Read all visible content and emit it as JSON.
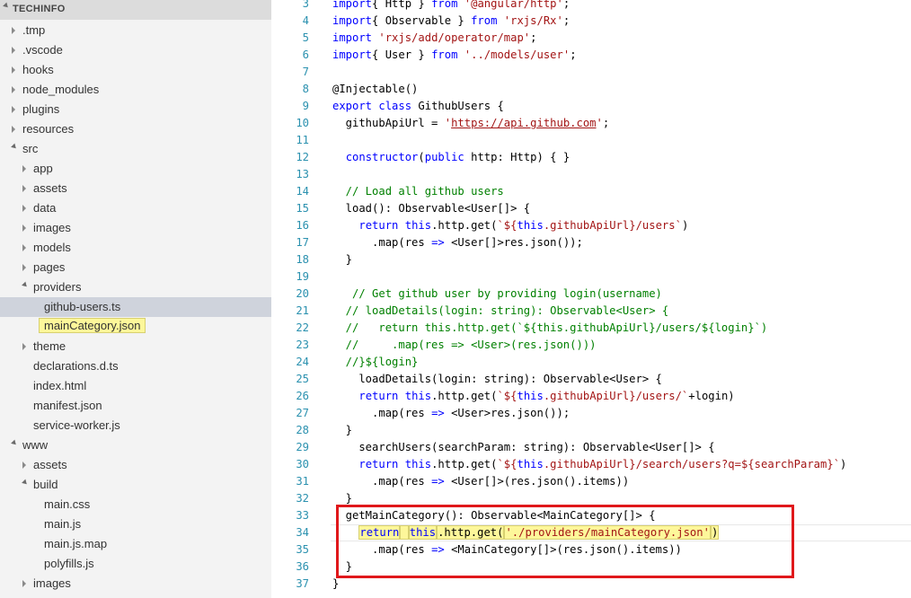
{
  "explorer": {
    "section_title": "TECHINFO",
    "items": [
      {
        "label": ".tmp",
        "depth": 1,
        "twisty": "closed"
      },
      {
        "label": ".vscode",
        "depth": 1,
        "twisty": "closed"
      },
      {
        "label": "hooks",
        "depth": 1,
        "twisty": "closed"
      },
      {
        "label": "node_modules",
        "depth": 1,
        "twisty": "closed"
      },
      {
        "label": "plugins",
        "depth": 1,
        "twisty": "closed"
      },
      {
        "label": "resources",
        "depth": 1,
        "twisty": "closed"
      },
      {
        "label": "src",
        "depth": 1,
        "twisty": "open"
      },
      {
        "label": "app",
        "depth": 2,
        "twisty": "closed"
      },
      {
        "label": "assets",
        "depth": 2,
        "twisty": "closed"
      },
      {
        "label": "data",
        "depth": 2,
        "twisty": "closed"
      },
      {
        "label": "images",
        "depth": 2,
        "twisty": "closed"
      },
      {
        "label": "models",
        "depth": 2,
        "twisty": "closed"
      },
      {
        "label": "pages",
        "depth": 2,
        "twisty": "closed"
      },
      {
        "label": "providers",
        "depth": 2,
        "twisty": "open"
      },
      {
        "label": "github-users.ts",
        "depth": 3,
        "twisty": "none",
        "selected": true
      },
      {
        "label": "mainCategory.json",
        "depth": 3,
        "twisty": "none",
        "highlighted": true
      },
      {
        "label": "theme",
        "depth": 2,
        "twisty": "closed"
      },
      {
        "label": "declarations.d.ts",
        "depth": 2,
        "twisty": "none"
      },
      {
        "label": "index.html",
        "depth": 2,
        "twisty": "none"
      },
      {
        "label": "manifest.json",
        "depth": 2,
        "twisty": "none"
      },
      {
        "label": "service-worker.js",
        "depth": 2,
        "twisty": "none"
      },
      {
        "label": "www",
        "depth": 1,
        "twisty": "open"
      },
      {
        "label": "assets",
        "depth": 2,
        "twisty": "closed"
      },
      {
        "label": "build",
        "depth": 2,
        "twisty": "open"
      },
      {
        "label": "main.css",
        "depth": 3,
        "twisty": "none"
      },
      {
        "label": "main.js",
        "depth": 3,
        "twisty": "none"
      },
      {
        "label": "main.js.map",
        "depth": 3,
        "twisty": "none"
      },
      {
        "label": "polyfills.js",
        "depth": 3,
        "twisty": "none"
      },
      {
        "label": "images",
        "depth": 2,
        "twisty": "closed"
      }
    ]
  },
  "editor": {
    "lines": [
      {
        "n": "3",
        "tokens": [
          [
            "kw",
            "import"
          ],
          [
            "",
            "{ Http } "
          ],
          [
            "kw",
            "from"
          ],
          [
            "str",
            " '@angular/http'"
          ],
          [
            "",
            ";"
          ]
        ]
      },
      {
        "n": "4",
        "tokens": [
          [
            "kw",
            "import"
          ],
          [
            "",
            "{ Observable } "
          ],
          [
            "kw",
            "from"
          ],
          [
            "str",
            " 'rxjs/Rx'"
          ],
          [
            "",
            ";"
          ]
        ]
      },
      {
        "n": "5",
        "tokens": [
          [
            "kw",
            "import"
          ],
          [
            "str",
            " 'rxjs/add/operator/map'"
          ],
          [
            "",
            ";"
          ]
        ]
      },
      {
        "n": "6",
        "tokens": [
          [
            "kw",
            "import"
          ],
          [
            "",
            "{ User } "
          ],
          [
            "kw",
            "from"
          ],
          [
            "str",
            " '../models/user'"
          ],
          [
            "",
            ";"
          ]
        ]
      },
      {
        "n": "7",
        "tokens": []
      },
      {
        "n": "8",
        "tokens": [
          [
            "",
            "@Injectable()"
          ]
        ]
      },
      {
        "n": "9",
        "tokens": [
          [
            "kw",
            "export"
          ],
          [
            "",
            " "
          ],
          [
            "kw",
            "class"
          ],
          [
            "",
            " GithubUsers {"
          ]
        ]
      },
      {
        "n": "10",
        "tokens": [
          [
            "",
            "  githubApiUrl = "
          ],
          [
            "str",
            "'"
          ],
          [
            "url",
            "https://api.github.com"
          ],
          [
            "str",
            "'"
          ],
          [
            "",
            ";"
          ]
        ]
      },
      {
        "n": "11",
        "tokens": []
      },
      {
        "n": "12",
        "tokens": [
          [
            "",
            "  "
          ],
          [
            "kw",
            "constructor"
          ],
          [
            "",
            "("
          ],
          [
            "kw",
            "public"
          ],
          [
            "",
            " http: Http) { }"
          ]
        ]
      },
      {
        "n": "13",
        "tokens": []
      },
      {
        "n": "14",
        "tokens": [
          [
            "cm",
            "  // Load all github users"
          ]
        ]
      },
      {
        "n": "15",
        "tokens": [
          [
            "",
            "  load(): Observable<User[]> {"
          ]
        ]
      },
      {
        "n": "16",
        "tokens": [
          [
            "",
            "    "
          ],
          [
            "kw",
            "return"
          ],
          [
            "",
            " "
          ],
          [
            "kw",
            "this"
          ],
          [
            "",
            ".http.get("
          ],
          [
            "str",
            "`${"
          ],
          [
            "kw",
            "this"
          ],
          [
            "str",
            ".githubApiUrl}/users`"
          ],
          [
            "",
            ")"
          ]
        ]
      },
      {
        "n": "17",
        "tokens": [
          [
            "",
            "      .map(res "
          ],
          [
            "kw",
            "=>"
          ],
          [
            "",
            " <User[]>res.json());"
          ]
        ]
      },
      {
        "n": "18",
        "tokens": [
          [
            "",
            "  }"
          ]
        ]
      },
      {
        "n": "19",
        "tokens": []
      },
      {
        "n": "20",
        "tokens": [
          [
            "cm",
            "   // Get github user by providing login(username)"
          ]
        ]
      },
      {
        "n": "21",
        "tokens": [
          [
            "cm",
            "  // loadDetails(login: string): Observable<User> {"
          ]
        ]
      },
      {
        "n": "22",
        "tokens": [
          [
            "cm",
            "  //   return this.http.get(`${this.githubApiUrl}/users/${login}`)"
          ]
        ]
      },
      {
        "n": "23",
        "tokens": [
          [
            "cm",
            "  //     .map(res => <User>(res.json()))"
          ]
        ]
      },
      {
        "n": "24",
        "tokens": [
          [
            "cm",
            "  //}${login}"
          ]
        ]
      },
      {
        "n": "25",
        "tokens": [
          [
            "",
            "    loadDetails(login: string): Observable<User> {"
          ]
        ]
      },
      {
        "n": "26",
        "tokens": [
          [
            "",
            "    "
          ],
          [
            "kw",
            "return"
          ],
          [
            "",
            " "
          ],
          [
            "kw",
            "this"
          ],
          [
            "",
            ".http.get("
          ],
          [
            "str",
            "`${"
          ],
          [
            "kw",
            "this"
          ],
          [
            "str",
            ".githubApiUrl}/users/`"
          ],
          [
            "",
            "+login)"
          ]
        ]
      },
      {
        "n": "27",
        "tokens": [
          [
            "",
            "      .map(res "
          ],
          [
            "kw",
            "=>"
          ],
          [
            "",
            " <User>res.json());"
          ]
        ]
      },
      {
        "n": "28",
        "tokens": [
          [
            "",
            "  }"
          ]
        ]
      },
      {
        "n": "29",
        "tokens": [
          [
            "",
            "    searchUsers(searchParam: string): Observable<User[]> {"
          ]
        ]
      },
      {
        "n": "30",
        "tokens": [
          [
            "",
            "    "
          ],
          [
            "kw",
            "return"
          ],
          [
            "",
            " "
          ],
          [
            "kw",
            "this"
          ],
          [
            "",
            ".http.get("
          ],
          [
            "str",
            "`${"
          ],
          [
            "kw",
            "this"
          ],
          [
            "str",
            ".githubApiUrl}/search/users?q=${searchParam}`"
          ],
          [
            "",
            ")"
          ]
        ]
      },
      {
        "n": "31",
        "tokens": [
          [
            "",
            "      .map(res "
          ],
          [
            "kw",
            "=>"
          ],
          [
            "",
            " <User[]>(res.json().items))"
          ]
        ]
      },
      {
        "n": "32",
        "tokens": [
          [
            "",
            "  }"
          ]
        ]
      },
      {
        "n": "33",
        "tokens": [
          [
            "",
            "  getMainCategory(): Observable<MainCategory[]> {"
          ]
        ]
      },
      {
        "n": "34",
        "tokens": [
          [
            "",
            "    "
          ],
          [
            "hlkw",
            "return"
          ],
          [
            "hl",
            " "
          ],
          [
            "hlkw",
            "this"
          ],
          [
            "hl",
            ".http.get("
          ],
          [
            "hlstr",
            "'./providers/mainCategory.json'"
          ],
          [
            "hl",
            ")"
          ]
        ]
      },
      {
        "n": "35",
        "tokens": [
          [
            "",
            "      .map(res "
          ],
          [
            "kw",
            "=>"
          ],
          [
            "",
            " <MainCategory[]>(res.json().items))"
          ]
        ]
      },
      {
        "n": "36",
        "tokens": [
          [
            "",
            "  }"
          ]
        ]
      },
      {
        "n": "37",
        "tokens": [
          [
            "",
            "}"
          ]
        ]
      }
    ]
  },
  "colors": {
    "keyword": "#0000ff",
    "string": "#a31515",
    "comment": "#008000",
    "line_number": "#2b91af",
    "highlight": "#fdf79a",
    "annotation_box": "#e0181b"
  }
}
